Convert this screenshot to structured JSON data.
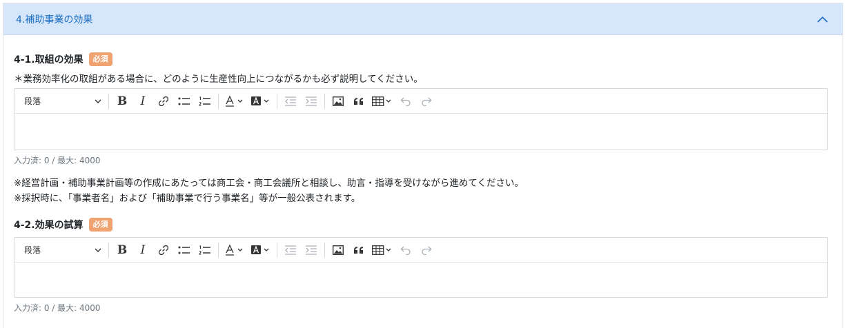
{
  "panel": {
    "title": "4.補助事業の効果"
  },
  "toolbar": {
    "paragraph_label": "段落",
    "bold_label": "B",
    "italic_label": "I"
  },
  "section1": {
    "label": "4-1.取組の効果",
    "badge": "必須",
    "description": "＊業務効率化の取組がある場合に、どのように生産性向上につながるかも必ず説明してください。",
    "counter": "入力済: 0 / 最大: 4000"
  },
  "notes": {
    "line1": "※経営計画・補助事業計画等の作成にあたっては商工会・商工会議所と相談し、助言・指導を受けながら進めてください。",
    "line2": "※採択時に、「事業者名」および「補助事業で行う事業名」等が一般公表されます。"
  },
  "section2": {
    "label": "4-2.効果の試算",
    "badge": "必須",
    "counter": "入力済: 0 / 最大: 4000"
  },
  "colors": {
    "header_bg": "#d6e6fb",
    "title_text": "#1d6fc3",
    "badge_bg": "#f0a271"
  }
}
